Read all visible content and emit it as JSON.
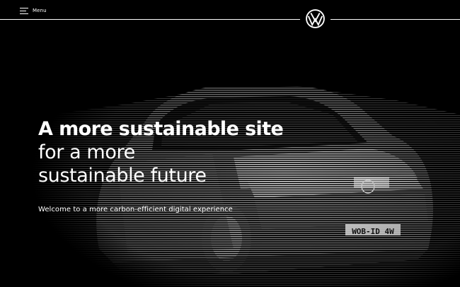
{
  "header": {
    "menu_label": "Menu",
    "logo_icon": "vw-logo-icon"
  },
  "hero": {
    "headline_bold": "A more sustainable site",
    "headline_line2": "for a more",
    "headline_line3": "sustainable future",
    "subtitle": "Welcome to a more carbon-efficient digital experience",
    "plate_text": "WOB-ID 4W"
  },
  "colors": {
    "background": "#000000",
    "text": "#ffffff"
  }
}
